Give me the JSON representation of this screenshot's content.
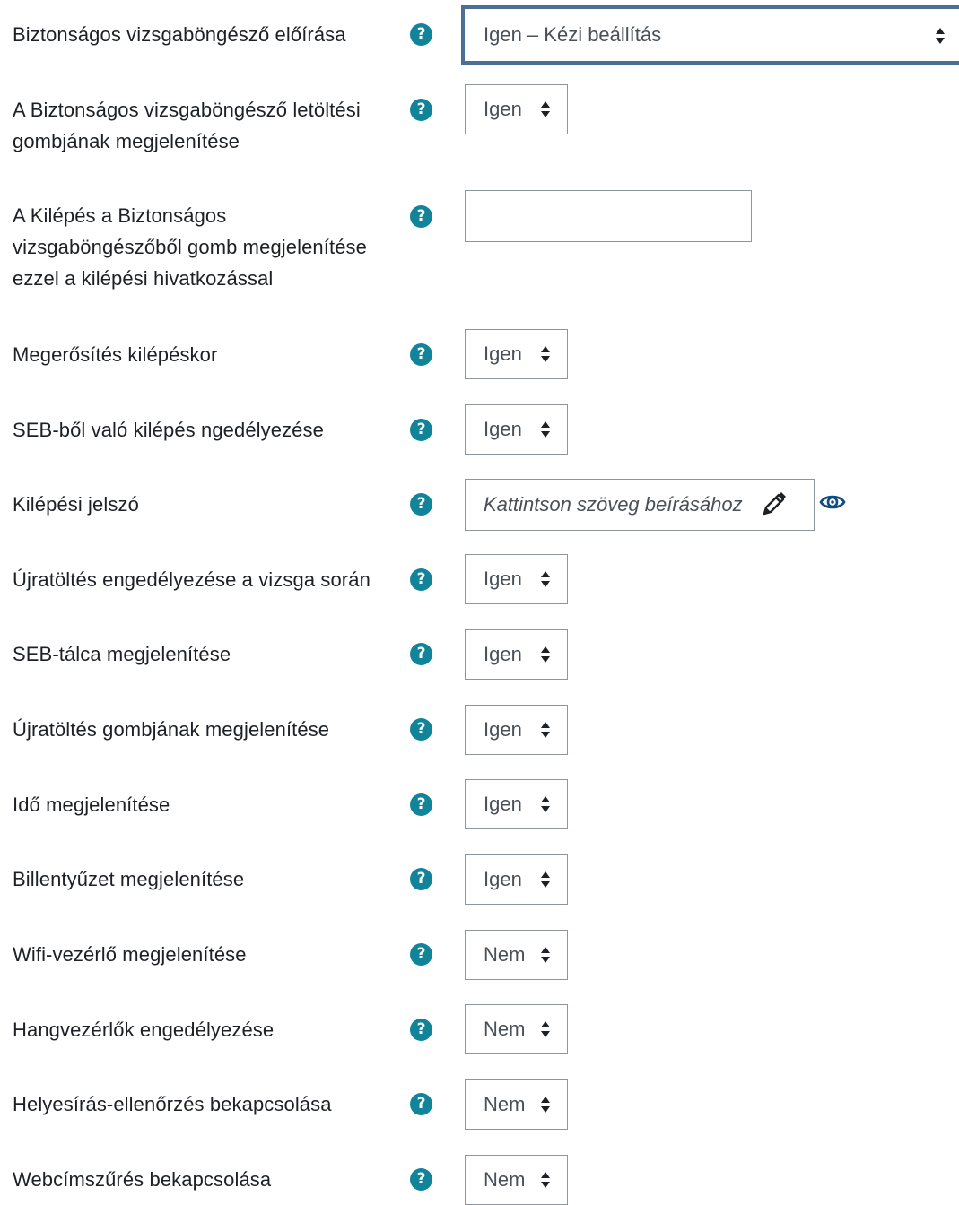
{
  "settings": [
    {
      "label": "Biztonságos vizsgaböngésző előírása",
      "control": "select-wide",
      "value": "Igen – Kézi beállítás",
      "help": "?"
    },
    {
      "label": "A Biztonságos vizsgaböngésző letöltési gombjának megjelenítése",
      "control": "select",
      "value": "Igen",
      "help": "?"
    },
    {
      "label": "A Kilépés a Biztonságos vizsgaböngészőből gomb megjelenítése ezzel a kilépési hivatkozással",
      "control": "text",
      "value": "",
      "help": "?"
    },
    {
      "label": "Megerősítés kilépéskor",
      "control": "select",
      "value": "Igen",
      "help": "?"
    },
    {
      "label": "SEB-ből való kilépés ngedélyezése",
      "control": "select",
      "value": "Igen",
      "help": "?"
    },
    {
      "label": "Kilépési jelszó",
      "control": "password",
      "placeholder": "Kattintson szöveg beírásához",
      "help": "?"
    },
    {
      "label": "Újratöltés engedélyezése a vizsga során",
      "control": "select",
      "value": "Igen",
      "help": "?"
    },
    {
      "label": "SEB-tálca megjelenítése",
      "control": "select",
      "value": "Igen",
      "help": "?"
    },
    {
      "label": "Újratöltés gombjának megjelenítése",
      "control": "select",
      "value": "Igen",
      "help": "?"
    },
    {
      "label": "Idő megjelenítése",
      "control": "select",
      "value": "Igen",
      "help": "?"
    },
    {
      "label": "Billentyűzet megjelenítése",
      "control": "select",
      "value": "Igen",
      "help": "?"
    },
    {
      "label": "Wifi-vezérlő megjelenítése",
      "control": "select",
      "value": "Nem",
      "help": "?"
    },
    {
      "label": "Hangvezérlők engedélyezése",
      "control": "select",
      "value": "Nem",
      "help": "?"
    },
    {
      "label": "Helyesírás-ellenőrzés bekapcsolása",
      "control": "select",
      "value": "Nem",
      "help": "?"
    },
    {
      "label": "Webcímszűrés bekapcsolása",
      "control": "select",
      "value": "Nem",
      "help": "?"
    }
  ],
  "icons": {
    "help": "help-circle-icon",
    "select_arrows": "sort-arrows-icon",
    "pencil": "pencil-icon",
    "eye": "eye-icon"
  },
  "colors": {
    "help_badge": "#11849a",
    "focus_border": "#4b6f95",
    "input_border": "#8f959e",
    "text": "#1d2125",
    "control_text": "#495057"
  }
}
